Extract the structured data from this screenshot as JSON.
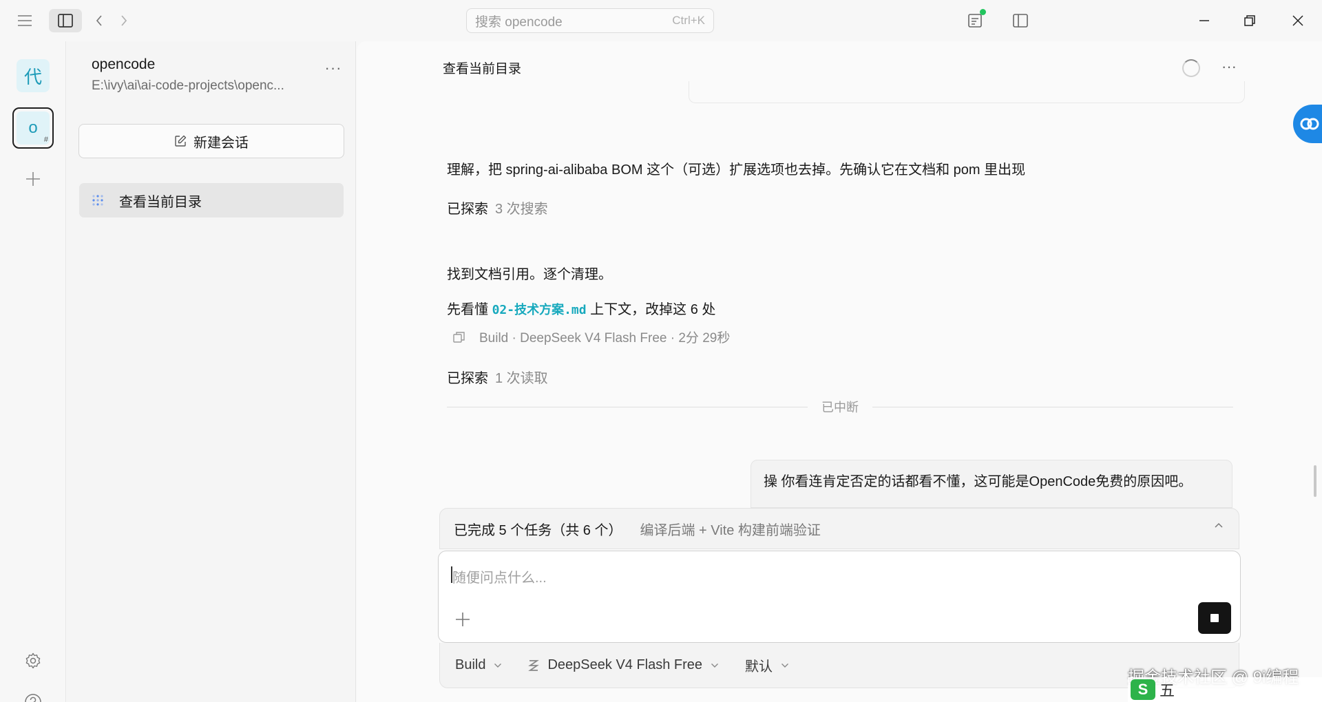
{
  "titlebar": {
    "search_placeholder": "搜索 opencode",
    "search_shortcut": "Ctrl+K",
    "status_dot_color": "#22c55e"
  },
  "rail": {
    "projects": [
      {
        "glyph": "代",
        "selected": false
      },
      {
        "glyph": "o",
        "badge": "#",
        "selected": true
      }
    ],
    "icons": [
      "add-icon",
      "settings-icon",
      "help-icon"
    ]
  },
  "sidebar": {
    "project_name": "opencode",
    "project_path": "E:\\ivy\\ai\\ai-code-projects\\openc...",
    "more": "···",
    "new_session_label": "新建会话",
    "sessions": [
      {
        "title": "查看当前目录",
        "active": true
      }
    ]
  },
  "main": {
    "session_title": "查看当前目录",
    "messages": {
      "m1": "理解，把 spring-ai-alibaba BOM 这个（可选）扩展选项也去掉。先确认它在文档和 pom 里出现",
      "explored1_label": "已探索",
      "explored1_detail": "3 次搜索",
      "m2": "找到文档引用。逐个清理。",
      "m3_prefix": "先看懂 ",
      "m3_code": "02-技术方案.md",
      "m3_suffix": " 上下文，改掉这 6 处",
      "meta": "Build · DeepSeek V4 Flash Free · 2分 29秒",
      "explored2_label": "已探索",
      "explored2_detail": "1 次读取"
    },
    "divider_label": "已中断",
    "user_message": "操 你看连肯定否定的话都看不懂，这可能是OpenCode免费的原因吧。"
  },
  "tasks": {
    "summary": "已完成 5 个任务（共 6 个）",
    "detail": "编译后端 + Vite 构建前端验证"
  },
  "composer": {
    "placeholder": "随便问点什么..."
  },
  "footer": {
    "agent": "Build",
    "model": "DeepSeek V4 Flash Free",
    "variant": "默认"
  },
  "overlay": {
    "watermark": "掘金技术社区 @ 9i编程",
    "ime_logo": "S",
    "ime_mode": "五"
  }
}
